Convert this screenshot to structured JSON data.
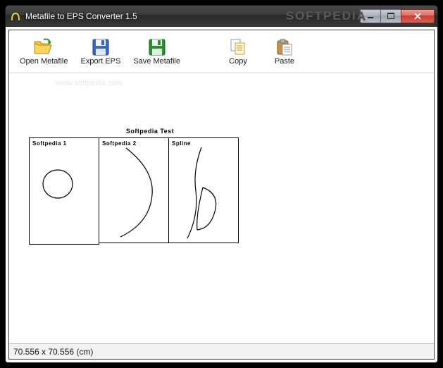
{
  "window": {
    "title": "Metafile to EPS Converter 1.5"
  },
  "watermark": "SOFTPEDIA",
  "watermark_url": "www.softpedia.com",
  "toolbar": {
    "open": "Open Metafile",
    "export": "Export EPS",
    "save": "Save Metafile",
    "copy": "Copy",
    "paste": "Paste"
  },
  "drawing": {
    "title": "Softpedia Test",
    "panels": [
      {
        "label": "Softpedia 1"
      },
      {
        "label": "Softpedia 2"
      },
      {
        "label": "Spline"
      }
    ]
  },
  "status": "70.556 x 70.556 (cm)"
}
